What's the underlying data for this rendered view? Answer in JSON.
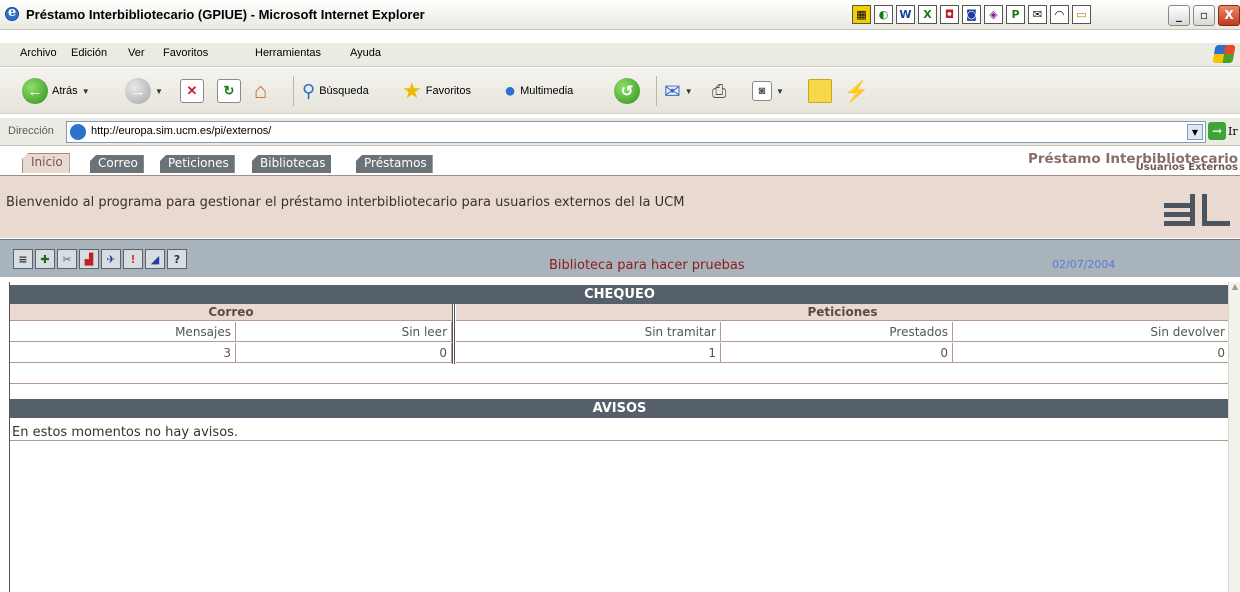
{
  "window": {
    "title": "Préstamo Interbibliotecario (GPIUE) - Microsoft Internet Explorer",
    "tray_icons": [
      "app-icon-1",
      "app-icon-2",
      "word-icon",
      "excel-icon",
      "app-icon-5",
      "app-icon-6",
      "app-icon-7",
      "publisher-icon",
      "mail-icon",
      "app-icon-10",
      "folder-icon"
    ],
    "controls": {
      "minimize": "_",
      "maximize": "▫",
      "close": "X"
    }
  },
  "menu": [
    "Archivo",
    "Edición",
    "Ver",
    "Favoritos",
    "Herramientas",
    "Ayuda"
  ],
  "toolbar": {
    "back": "Atrás",
    "search": "Búsqueda",
    "favorites": "Favoritos",
    "media": "Multimedia"
  },
  "address": {
    "label": "Dirección",
    "url": "http://europa.sim.ucm.es/pi/externos/",
    "go": "Ir"
  },
  "app": {
    "tabs": [
      "Inicio",
      "Correo",
      "Peticiones",
      "Bibliotecas",
      "Préstamos"
    ],
    "brand_title": "Préstamo Interbibliotecario",
    "brand_subtitle": "Usuarios Externos",
    "welcome": "Bienvenido al programa para gestionar el préstamo interbibliotecario para usuarios externos del la UCM",
    "library": "Biblioteca para hacer pruebas",
    "date": "02/07/2004",
    "tool_icons": [
      "list-icon",
      "add-icon",
      "tools-icon",
      "chart-icon",
      "user-icon",
      "info-icon",
      "bell-icon",
      "help-icon"
    ]
  },
  "chequeo": {
    "title": "CHEQUEO",
    "correo": {
      "title": "Correo",
      "columns": [
        "Mensajes",
        "Sin leer"
      ],
      "values": [
        "3",
        "0"
      ]
    },
    "peticiones": {
      "title": "Peticiones",
      "columns": [
        "Sin tramitar",
        "Prestados",
        "Sin devolver"
      ],
      "values": [
        "1",
        "0",
        "0"
      ]
    }
  },
  "avisos": {
    "title": "AVISOS",
    "message": "En estos momentos no hay avisos."
  },
  "colors": {
    "header_bg": "#56606a",
    "pink_bg": "#ead9d1",
    "library_text": "#8d1c1c",
    "date_text": "#5e7ad9"
  }
}
